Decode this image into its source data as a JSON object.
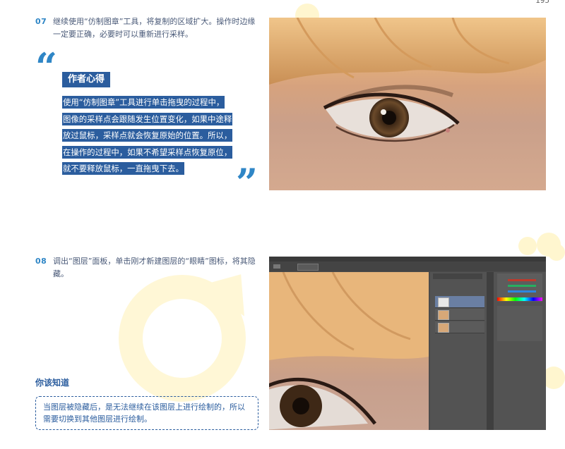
{
  "page_number": "195",
  "step07": {
    "number": "07",
    "text": "继续使用“仿制图章”工具，将复制的区域扩大。操作时边缘一定要正确，必要时可以重新进行采样。"
  },
  "author_note": {
    "title": "作者心得",
    "lines": [
      "使用“仿制图章”工具进行单击拖曳的过程中，",
      "图像的采样点会跟随发生位置变化，如果中途释",
      "放过鼠标，采样点就会恢复原始的位置。所以，",
      "在操作的过程中，如果不希望采样点恢复原位，",
      "就不要释放鼠标，一直拖曳下去。"
    ]
  },
  "step08": {
    "number": "08",
    "text": "调出“图层”面板，单击刚才新建图层的“眼睛”图标，将其隐藏。"
  },
  "tip": {
    "title": "你该知道",
    "text": "当图层被隐藏后，是无法继续在该图层上进行绘制的，所以需要切换到其他图层进行绘制。"
  },
  "colors": {
    "accent_blue": "#2f86c6",
    "heading_navy": "#2b5d9e",
    "body_text": "#4a5a78",
    "decor_yellow": "#fff6cf"
  }
}
